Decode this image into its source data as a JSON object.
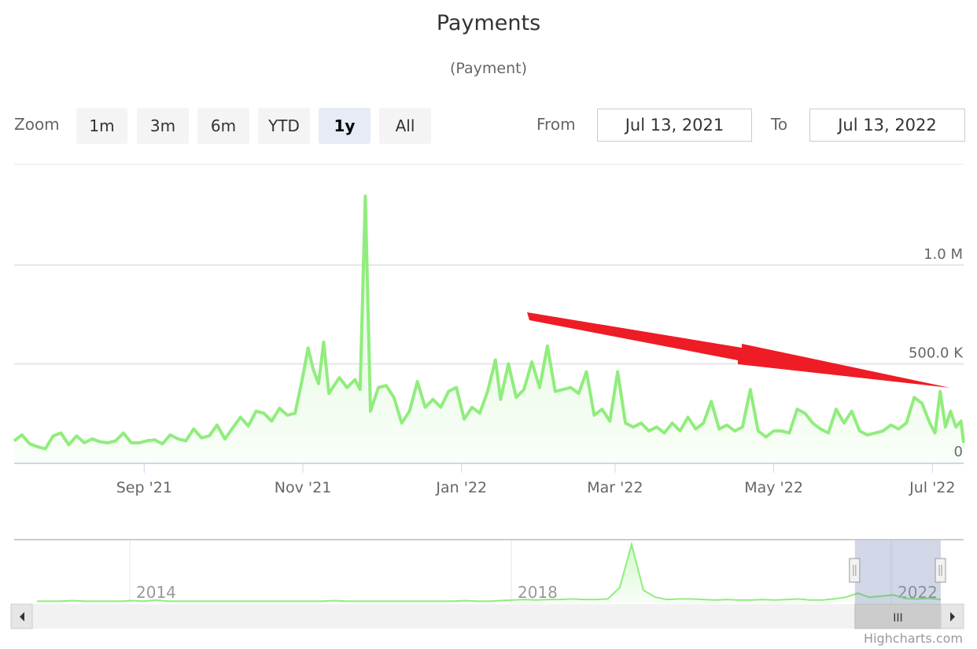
{
  "chart_data": {
    "type": "area",
    "title": "Payments",
    "subtitle": "(Payment)",
    "xlabel": "",
    "ylabel": "",
    "series_name": "Payment",
    "series_color": "#90ed7d",
    "y_ticks": [
      {
        "value": 0,
        "label": "0"
      },
      {
        "value": 500000,
        "label": "500.0 K"
      },
      {
        "value": 1000000,
        "label": "1.0 M"
      }
    ],
    "ylim": [
      0,
      1350000
    ],
    "x_range": [
      "2021-07-13",
      "2022-07-13"
    ],
    "x_ticks": [
      {
        "date": "2021-09-01",
        "label": "Sep '21"
      },
      {
        "date": "2021-11-01",
        "label": "Nov '21"
      },
      {
        "date": "2022-01-01",
        "label": "Jan '22"
      },
      {
        "date": "2022-03-01",
        "label": "Mar '22"
      },
      {
        "date": "2022-05-01",
        "label": "May '22"
      },
      {
        "date": "2022-07-01",
        "label": "Jul '22"
      }
    ],
    "grid": true,
    "points": [
      [
        "2021-07-13",
        110000
      ],
      [
        "2021-07-16",
        140000
      ],
      [
        "2021-07-19",
        95000
      ],
      [
        "2021-07-22",
        80000
      ],
      [
        "2021-07-25",
        70000
      ],
      [
        "2021-07-28",
        135000
      ],
      [
        "2021-07-31",
        150000
      ],
      [
        "2021-08-03",
        90000
      ],
      [
        "2021-08-06",
        135000
      ],
      [
        "2021-08-09",
        100000
      ],
      [
        "2021-08-12",
        120000
      ],
      [
        "2021-08-15",
        105000
      ],
      [
        "2021-08-18",
        100000
      ],
      [
        "2021-08-21",
        110000
      ],
      [
        "2021-08-24",
        150000
      ],
      [
        "2021-08-27",
        100000
      ],
      [
        "2021-08-30",
        100000
      ],
      [
        "2021-09-02",
        110000
      ],
      [
        "2021-09-05",
        115000
      ],
      [
        "2021-09-08",
        95000
      ],
      [
        "2021-09-11",
        140000
      ],
      [
        "2021-09-14",
        120000
      ],
      [
        "2021-09-17",
        110000
      ],
      [
        "2021-09-20",
        170000
      ],
      [
        "2021-09-23",
        125000
      ],
      [
        "2021-09-26",
        135000
      ],
      [
        "2021-09-29",
        190000
      ],
      [
        "2021-10-02",
        120000
      ],
      [
        "2021-10-05",
        175000
      ],
      [
        "2021-10-08",
        230000
      ],
      [
        "2021-10-11",
        185000
      ],
      [
        "2021-10-14",
        260000
      ],
      [
        "2021-10-17",
        250000
      ],
      [
        "2021-10-20",
        210000
      ],
      [
        "2021-10-23",
        275000
      ],
      [
        "2021-10-26",
        240000
      ],
      [
        "2021-10-29",
        250000
      ],
      [
        "2021-11-01",
        440000
      ],
      [
        "2021-11-03",
        580000
      ],
      [
        "2021-11-05",
        470000
      ],
      [
        "2021-11-07",
        400000
      ],
      [
        "2021-11-09",
        610000
      ],
      [
        "2021-11-11",
        350000
      ],
      [
        "2021-11-13",
        390000
      ],
      [
        "2021-11-15",
        430000
      ],
      [
        "2021-11-18",
        380000
      ],
      [
        "2021-11-21",
        420000
      ],
      [
        "2021-11-23",
        370000
      ],
      [
        "2021-11-25",
        1350000
      ],
      [
        "2021-11-27",
        260000
      ],
      [
        "2021-11-30",
        380000
      ],
      [
        "2021-12-03",
        390000
      ],
      [
        "2021-12-06",
        330000
      ],
      [
        "2021-12-09",
        200000
      ],
      [
        "2021-12-12",
        260000
      ],
      [
        "2021-12-15",
        410000
      ],
      [
        "2021-12-18",
        280000
      ],
      [
        "2021-12-21",
        320000
      ],
      [
        "2021-12-24",
        280000
      ],
      [
        "2021-12-27",
        360000
      ],
      [
        "2021-12-30",
        380000
      ],
      [
        "2022-01-02",
        220000
      ],
      [
        "2022-01-05",
        280000
      ],
      [
        "2022-01-08",
        250000
      ],
      [
        "2022-01-11",
        360000
      ],
      [
        "2022-01-14",
        520000
      ],
      [
        "2022-01-16",
        320000
      ],
      [
        "2022-01-19",
        500000
      ],
      [
        "2022-01-22",
        330000
      ],
      [
        "2022-01-25",
        370000
      ],
      [
        "2022-01-28",
        510000
      ],
      [
        "2022-01-31",
        380000
      ],
      [
        "2022-02-03",
        590000
      ],
      [
        "2022-02-06",
        360000
      ],
      [
        "2022-02-09",
        370000
      ],
      [
        "2022-02-12",
        380000
      ],
      [
        "2022-02-15",
        350000
      ],
      [
        "2022-02-18",
        460000
      ],
      [
        "2022-02-21",
        240000
      ],
      [
        "2022-02-24",
        270000
      ],
      [
        "2022-02-27",
        210000
      ],
      [
        "2022-03-02",
        460000
      ],
      [
        "2022-03-05",
        200000
      ],
      [
        "2022-03-08",
        180000
      ],
      [
        "2022-03-11",
        200000
      ],
      [
        "2022-03-14",
        160000
      ],
      [
        "2022-03-17",
        180000
      ],
      [
        "2022-03-20",
        150000
      ],
      [
        "2022-03-23",
        200000
      ],
      [
        "2022-03-26",
        160000
      ],
      [
        "2022-03-29",
        230000
      ],
      [
        "2022-04-01",
        170000
      ],
      [
        "2022-04-04",
        200000
      ],
      [
        "2022-04-07",
        310000
      ],
      [
        "2022-04-10",
        170000
      ],
      [
        "2022-04-13",
        190000
      ],
      [
        "2022-04-16",
        160000
      ],
      [
        "2022-04-19",
        180000
      ],
      [
        "2022-04-22",
        370000
      ],
      [
        "2022-04-25",
        160000
      ],
      [
        "2022-04-28",
        130000
      ],
      [
        "2022-05-01",
        160000
      ],
      [
        "2022-05-04",
        160000
      ],
      [
        "2022-05-07",
        150000
      ],
      [
        "2022-05-10",
        270000
      ],
      [
        "2022-05-13",
        250000
      ],
      [
        "2022-05-16",
        200000
      ],
      [
        "2022-05-19",
        170000
      ],
      [
        "2022-05-22",
        150000
      ],
      [
        "2022-05-25",
        270000
      ],
      [
        "2022-05-28",
        200000
      ],
      [
        "2022-05-31",
        260000
      ],
      [
        "2022-06-03",
        160000
      ],
      [
        "2022-06-06",
        140000
      ],
      [
        "2022-06-09",
        150000
      ],
      [
        "2022-06-12",
        160000
      ],
      [
        "2022-06-15",
        190000
      ],
      [
        "2022-06-18",
        170000
      ],
      [
        "2022-06-21",
        200000
      ],
      [
        "2022-06-24",
        330000
      ],
      [
        "2022-06-27",
        300000
      ],
      [
        "2022-06-30",
        200000
      ],
      [
        "2022-07-02",
        150000
      ],
      [
        "2022-07-04",
        360000
      ],
      [
        "2022-07-06",
        180000
      ],
      [
        "2022-07-08",
        260000
      ],
      [
        "2022-07-10",
        180000
      ],
      [
        "2022-07-12",
        210000
      ],
      [
        "2022-07-13",
        100000
      ]
    ]
  },
  "header": {
    "title": "Payments",
    "subtitle": "(Payment)"
  },
  "range_selector": {
    "zoom_label": "Zoom",
    "buttons": [
      {
        "label": "1m",
        "active": false
      },
      {
        "label": "3m",
        "active": false
      },
      {
        "label": "6m",
        "active": false
      },
      {
        "label": "YTD",
        "active": false
      },
      {
        "label": "1y",
        "active": true
      },
      {
        "label": "All",
        "active": false
      }
    ],
    "from_label": "From",
    "from_value": "Jul 13, 2021",
    "to_label": "To",
    "to_value": "Jul 13, 2022"
  },
  "navigator": {
    "year_labels": [
      "2014",
      "2018",
      "2022"
    ],
    "selected_range_fraction": [
      0.905,
      1.0
    ],
    "series": [
      0.01,
      0.01,
      0.01,
      0.02,
      0.01,
      0.01,
      0.01,
      0.01,
      0.02,
      0.01,
      0.03,
      0.01,
      0.01,
      0.01,
      0.01,
      0.01,
      0.01,
      0.01,
      0.01,
      0.01,
      0.01,
      0.01,
      0.01,
      0.01,
      0.01,
      0.02,
      0.01,
      0.01,
      0.01,
      0.01,
      0.01,
      0.01,
      0.01,
      0.01,
      0.01,
      0.01,
      0.02,
      0.01,
      0.01,
      0.02,
      0.03,
      0.04,
      0.03,
      0.04,
      0.04,
      0.05,
      0.04,
      0.04,
      0.05,
      0.25,
      1.0,
      0.2,
      0.08,
      0.04,
      0.05,
      0.05,
      0.04,
      0.03,
      0.04,
      0.03,
      0.03,
      0.04,
      0.03,
      0.04,
      0.05,
      0.03,
      0.03,
      0.05,
      0.08,
      0.15,
      0.08,
      0.1,
      0.12,
      0.06,
      0.05,
      0.06,
      0.04
    ]
  },
  "annotation": {
    "type": "arrow",
    "color": "#ee1c25",
    "direction": "downward-trend"
  },
  "scrollbar": {
    "left_arrow": "left-arrow",
    "right_arrow": "right-arrow",
    "thumb_grip": "III"
  },
  "credits": "Highcharts.com"
}
